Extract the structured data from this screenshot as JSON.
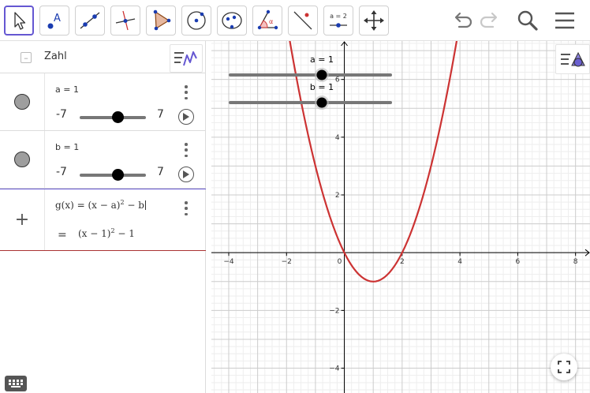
{
  "toolbar": {
    "tools": [
      {
        "name": "move-tool",
        "icon": "pointer-arrow-icon",
        "active": true
      },
      {
        "name": "point-tool",
        "icon": "point-a-icon",
        "label": "A"
      },
      {
        "name": "line-tool",
        "icon": "line-through-points-icon"
      },
      {
        "name": "perpendicular-line-tool",
        "icon": "perpendicular-line-icon"
      },
      {
        "name": "polygon-tool",
        "icon": "polygon-icon"
      },
      {
        "name": "circle-center-point-tool",
        "icon": "circle-center-icon"
      },
      {
        "name": "ellipse-tool",
        "icon": "ellipse-icon"
      },
      {
        "name": "angle-tool",
        "icon": "angle-icon",
        "label": "α"
      },
      {
        "name": "reflect-tool",
        "icon": "reflect-about-line-icon"
      },
      {
        "name": "slider-tool",
        "icon": "slider-icon",
        "label": "a = 2"
      },
      {
        "name": "move-graphics-view-tool",
        "icon": "move-cross-icon"
      }
    ],
    "undo_icon": "undo-icon",
    "redo_icon": "redo-icon",
    "search_icon": "search-icon",
    "menu_icon": "menu-icon"
  },
  "algebra": {
    "header_title": "Zahl",
    "collapse_symbol": "–",
    "rows": [
      {
        "definition": "a = 1",
        "min": "-7",
        "max": "7",
        "value": 1,
        "min_value": -7,
        "max_value": 7
      },
      {
        "definition": "b = 1",
        "min": "-7",
        "max": "7",
        "value": 1,
        "min_value": -7,
        "max_value": 7
      }
    ],
    "input": {
      "plus": "+",
      "formula_prefix": "g(x) = (x − a)",
      "formula_exp": "2",
      "formula_suffix": " − b",
      "result_eq": "=",
      "result_prefix": "(x − 1)",
      "result_exp": "2",
      "result_suffix": " − 1"
    }
  },
  "graphics": {
    "sliders": [
      {
        "label": "a = 1",
        "value": 1,
        "min": -7,
        "max": 7
      },
      {
        "label": "b = 1",
        "value": 1,
        "min": -7,
        "max": 7
      }
    ],
    "x_ticks": [
      "−4",
      "−2",
      "0",
      "2",
      "4",
      "6",
      "8"
    ],
    "y_ticks": [
      "6",
      "4",
      "2",
      "−2",
      "−4"
    ],
    "function": {
      "a": 1,
      "b": 1,
      "color": "#cc3333"
    },
    "view": {
      "xmin": -4.6,
      "xmax": 8.5,
      "ymin": -4.86,
      "ymax": 7.33
    }
  },
  "colors": {
    "accent": "#6557d2",
    "curve": "#cc3333",
    "grid_minor": "#eeeeee",
    "grid_major": "#cccccc",
    "axis": "#000000"
  }
}
